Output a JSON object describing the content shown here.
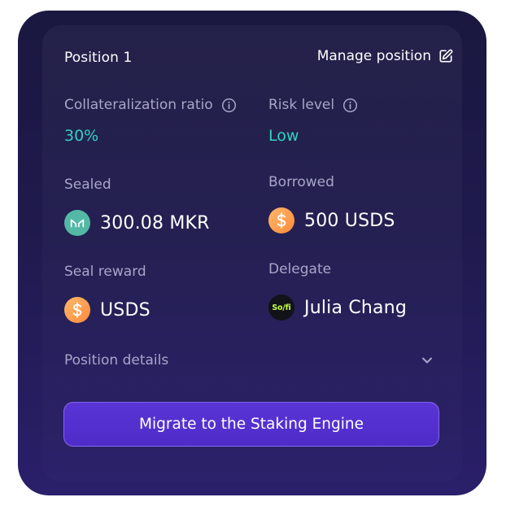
{
  "header": {
    "title": "Position 1",
    "manage_label": "Manage position"
  },
  "stats": {
    "collateralization": {
      "label": "Collateralization ratio",
      "value": "30%"
    },
    "risk": {
      "label": "Risk level",
      "value": "Low"
    },
    "sealed": {
      "label": "Sealed",
      "value": "300.08 MKR",
      "icon": "mkr-token-icon"
    },
    "borrowed": {
      "label": "Borrowed",
      "value": "500 USDS",
      "icon": "usds-token-icon"
    },
    "seal_reward": {
      "label": "Seal reward",
      "value": "USDS",
      "icon": "usds-token-icon"
    },
    "delegate": {
      "label": "Delegate",
      "value": "Julia Chang",
      "avatar_text": "So/fi"
    }
  },
  "details": {
    "label": "Position details"
  },
  "actions": {
    "migrate_label": "Migrate to the Staking Engine"
  },
  "colors": {
    "accent": "#2fd3c0",
    "button": "#5230d0",
    "card_bg": "#1d1946",
    "muted_text": "#a7a6c9"
  }
}
